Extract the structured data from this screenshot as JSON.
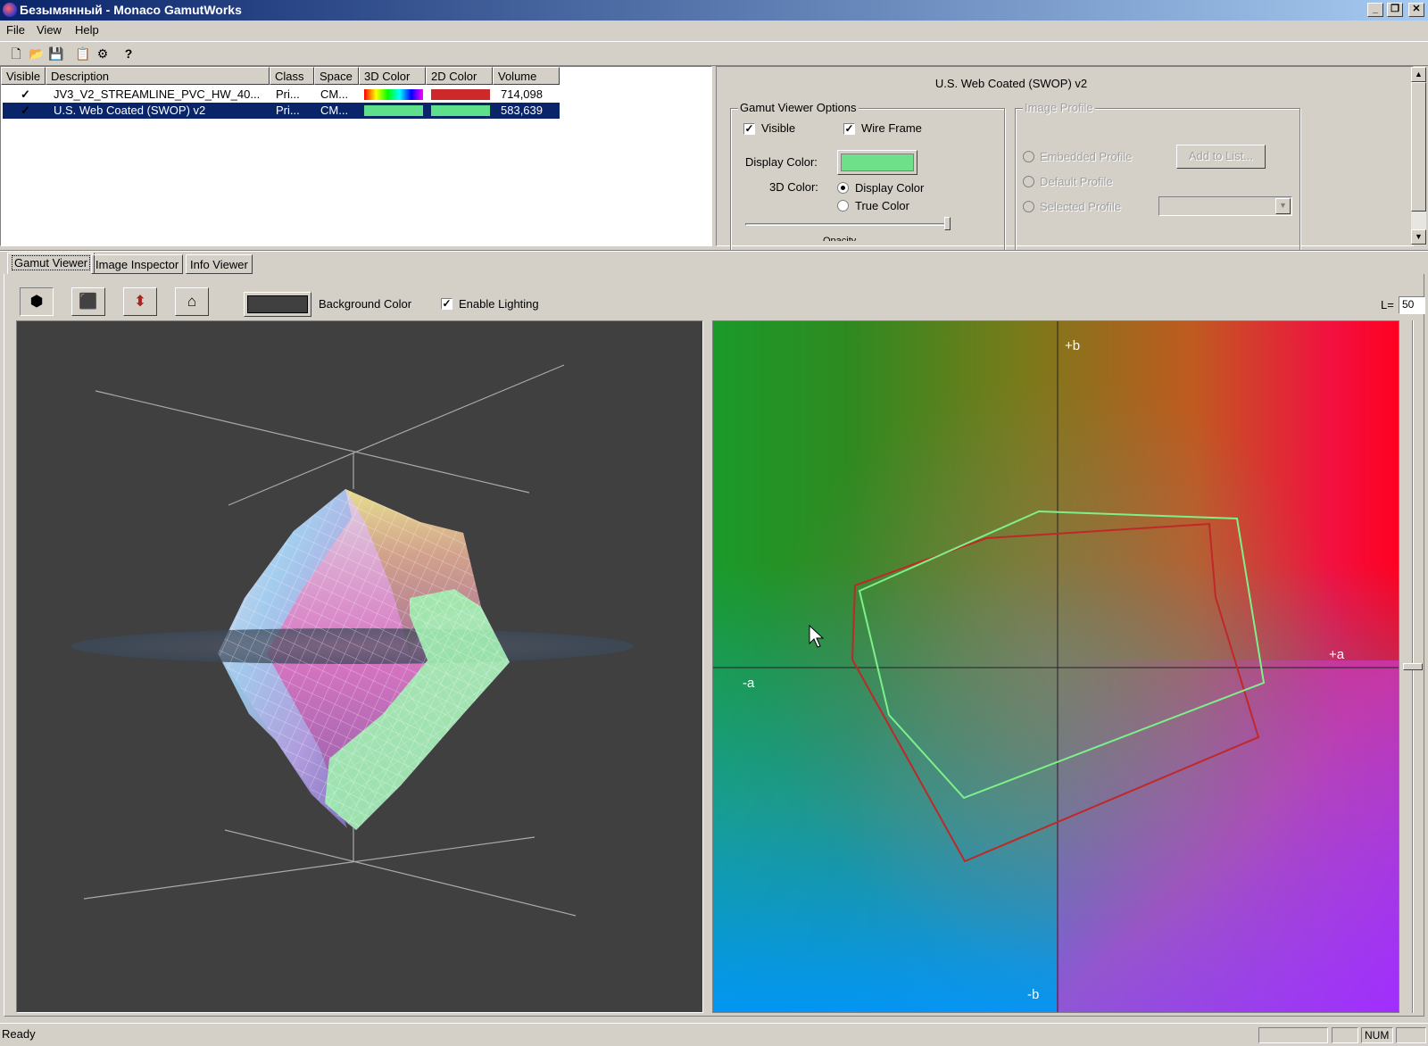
{
  "window": {
    "title": "Безымянный - Monaco GamutWorks"
  },
  "menu": [
    "File",
    "View",
    "Help"
  ],
  "toolbar": {
    "icons": [
      "new-icon",
      "open-icon",
      "save-icon",
      "import-icon",
      "export-icon",
      "help-icon"
    ]
  },
  "list": {
    "columns": [
      "Visible",
      "Description",
      "Class",
      "Space",
      "3D Color",
      "2D Color",
      "Volume"
    ],
    "rows": [
      {
        "visible": "✓",
        "description": "JV3_V2_STREAMLINE_PVC_HW_40...",
        "class": "Pri...",
        "space": "CM...",
        "color3d": "spectrum",
        "color2d": "#cc2a2a",
        "volume": "714,098",
        "selected": false
      },
      {
        "visible": "✓",
        "description": "U.S. Web Coated (SWOP) v2",
        "class": "Pri...",
        "space": "CM...",
        "color3d": "#5ee08a",
        "color2d": "#5ee08a",
        "volume": "583,639",
        "selected": true
      }
    ]
  },
  "options": {
    "profile_title": "U.S. Web Coated (SWOP) v2",
    "gamut_group": "Gamut Viewer Options",
    "visible_label": "Visible",
    "wireframe_label": "Wire Frame",
    "display_color_label": "Display Color:",
    "display_color": "#6ee08a",
    "color3d_label": "3D Color:",
    "display_color_radio": "Display Color",
    "true_color_radio": "True Color",
    "opacity_label": "Opacity",
    "image_group": "Image Profile",
    "embedded_profile": "Embedded Profile",
    "default_profile": "Default Profile",
    "selected_profile": "Selected Profile",
    "add_to_list": "Add to List..."
  },
  "tabs": [
    "Gamut Viewer",
    "Image Inspector",
    "Info Viewer"
  ],
  "viewer_toolbar": {
    "icons": [
      "rotate-view-icon",
      "front-view-icon",
      "side-view-icon",
      "home-view-icon"
    ],
    "background_label": "Background Color",
    "background_color": "#404040",
    "lighting_label": "Enable Lighting",
    "l_label": "L=",
    "l_value": "50"
  },
  "plot2d": {
    "plus_b": "+b",
    "minus_b": "-b",
    "plus_a": "+a",
    "minus_a": "-a"
  },
  "status": {
    "text": "Ready",
    "num": "NUM"
  }
}
